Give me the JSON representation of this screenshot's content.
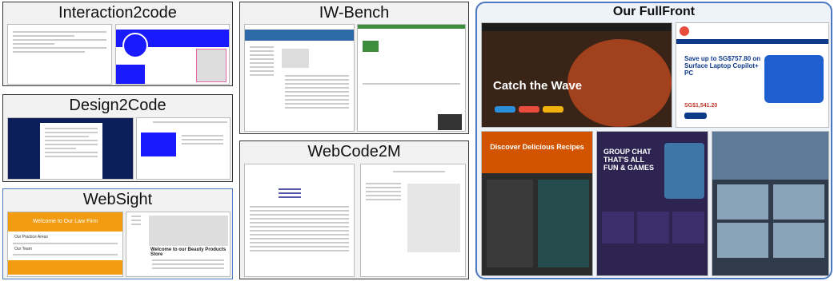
{
  "panels": {
    "interaction2code": {
      "title": "Interaction2code"
    },
    "design2code": {
      "title": "Design2Code"
    },
    "websight": {
      "title": "WebSight",
      "hero_text": "Welcome to Our Law Firm",
      "section1": "Our Practice Areas",
      "section2": "Our Team",
      "store_heading": "Welcome to our Beauty Products Store"
    },
    "iwbench": {
      "title": "IW-Bench"
    },
    "webcode2m": {
      "title": "WebCode2M"
    },
    "fullfront": {
      "title": "Our FullFront",
      "shot1_heading": "Catch the Wave",
      "shot2_heading": "Save up to SG$757.80 on Surface Laptop Copilot+ PC",
      "shot2_price": "SG$1,541.20",
      "shot3_heading": "Discover Delicious Recipes",
      "shot4_heading": "GROUP CHAT THAT'S ALL FUN & GAMES"
    }
  },
  "colors": {
    "fullfront_border": "#4a78c2",
    "websight_orange": "#f39c12",
    "design_navy": "#0d1f5a",
    "interaction_blue": "#1a1aff"
  }
}
